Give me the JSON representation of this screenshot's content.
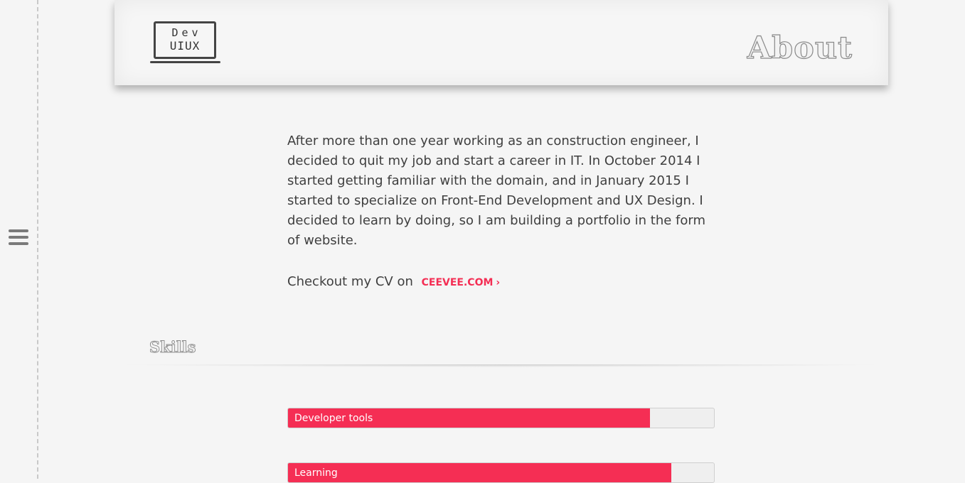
{
  "nav": {
    "menu_icon": "hamburger-menu-icon"
  },
  "header": {
    "logo_line1": "Dev",
    "logo_line2": "UIUX",
    "title": "About"
  },
  "about": {
    "text": "After more than one year working as an construction engineer, I decided to quit my job and start a career in IT. In October 2014 I started getting familiar with the domain, and in January 2015 I started to specialize on Front-End Development and UX Design. I decided to learn by doing, so I am building a portfolio in the form of website.",
    "cv_prefix": "Checkout my CV on",
    "cv_link": "CEEVEE.COM",
    "cv_arrow": "›"
  },
  "skills": {
    "title": "Skills",
    "items": [
      {
        "label": "Developer tools",
        "level": 0.85
      },
      {
        "label": "Learning",
        "level": 0.9
      }
    ]
  },
  "colors": {
    "accent": "#f52e54",
    "background": "#f5f5f5",
    "text": "#3f3f3f"
  }
}
